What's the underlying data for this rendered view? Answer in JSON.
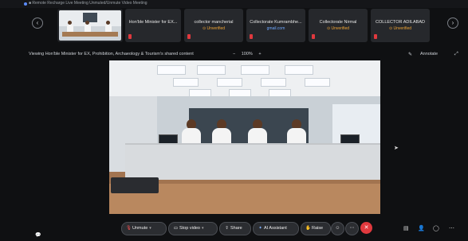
{
  "top_strip": {
    "text": "■ Remote Recharge Live Meeting   Unmuted/Unmute Video   Meeting"
  },
  "participants": [
    {
      "name": "Hon'ble Minister for EX...",
      "status": "",
      "type": "video"
    },
    {
      "name": "collector mancherial",
      "status": "⊙ Unverified"
    },
    {
      "name": "Collectorate Kumrambhe...",
      "status": "gmail.com"
    },
    {
      "name": "Collectorate Nirmal",
      "status": "⊙ Unverified"
    },
    {
      "name": "COLLECTOR ADILABAD",
      "status": "⊙ Unverified"
    }
  ],
  "nav": {
    "prev": "‹",
    "next": "›"
  },
  "share_bar": {
    "title": "Viewing Hon'ble Minister for EX, Prohibition, Archaeology & Tourism's shared content",
    "zoom_minus": "−",
    "zoom_value": "100%",
    "zoom_plus": "+",
    "annotate": "Annotate",
    "annotate_icon": "pen-icon",
    "expand_icon": "expand-icon"
  },
  "toolbar": {
    "unmute": "Unmute",
    "stop_video": "Stop video",
    "share": "Share",
    "ai_assistant": "AI Assistant",
    "raise": "Raise",
    "icons": [
      "mic-muted-icon",
      "video-icon",
      "share-icon",
      "ai-icon",
      "hand-icon",
      "emoji-icon",
      "more-icon",
      "end-call-icon",
      "apps-icon",
      "participants-icon",
      "chat-icon",
      "more-options-icon"
    ]
  },
  "chat_icon": "💬"
}
